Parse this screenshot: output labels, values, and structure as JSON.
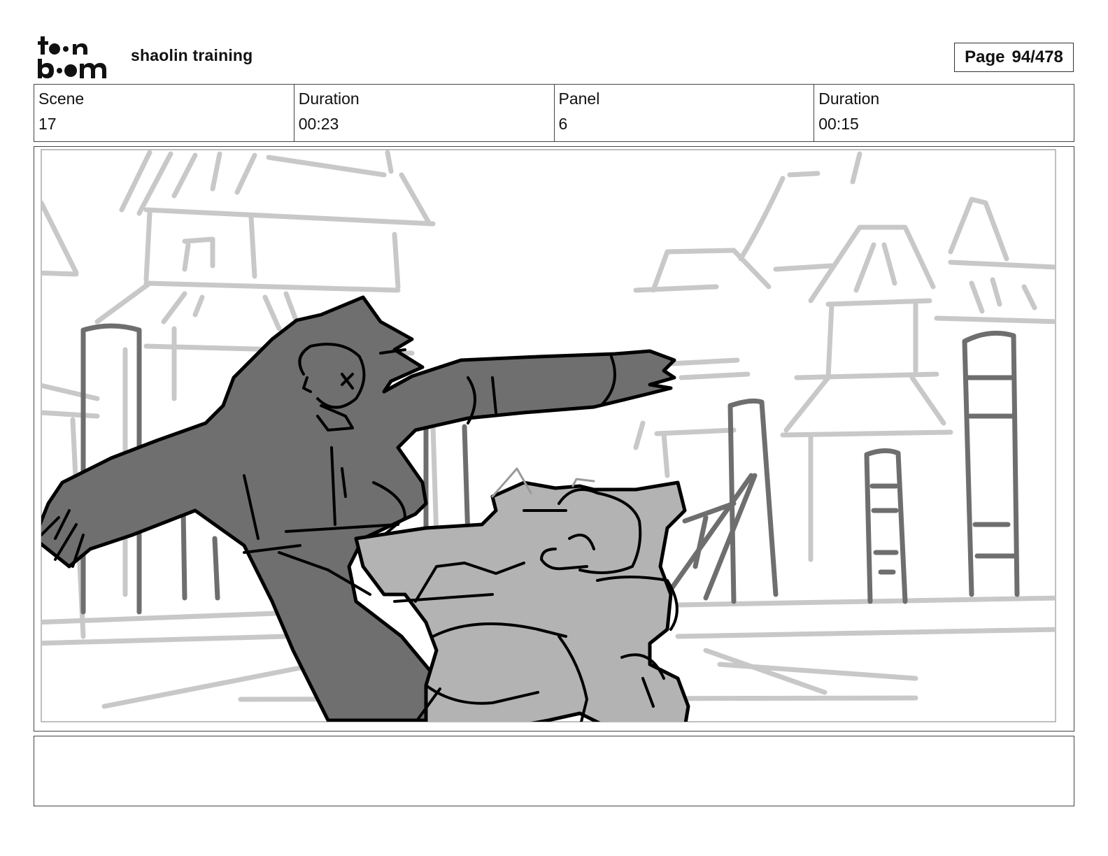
{
  "header": {
    "logo_text": "toonboom",
    "project_title": "shaolin training",
    "page_label": "Page",
    "page_value": "94/478"
  },
  "info": [
    {
      "label": "Scene",
      "value": "17"
    },
    {
      "label": "Duration",
      "value": "00:23"
    },
    {
      "label": "Panel",
      "value": "6"
    },
    {
      "label": "Duration",
      "value": "00:15"
    }
  ],
  "notes": {
    "text": ""
  }
}
